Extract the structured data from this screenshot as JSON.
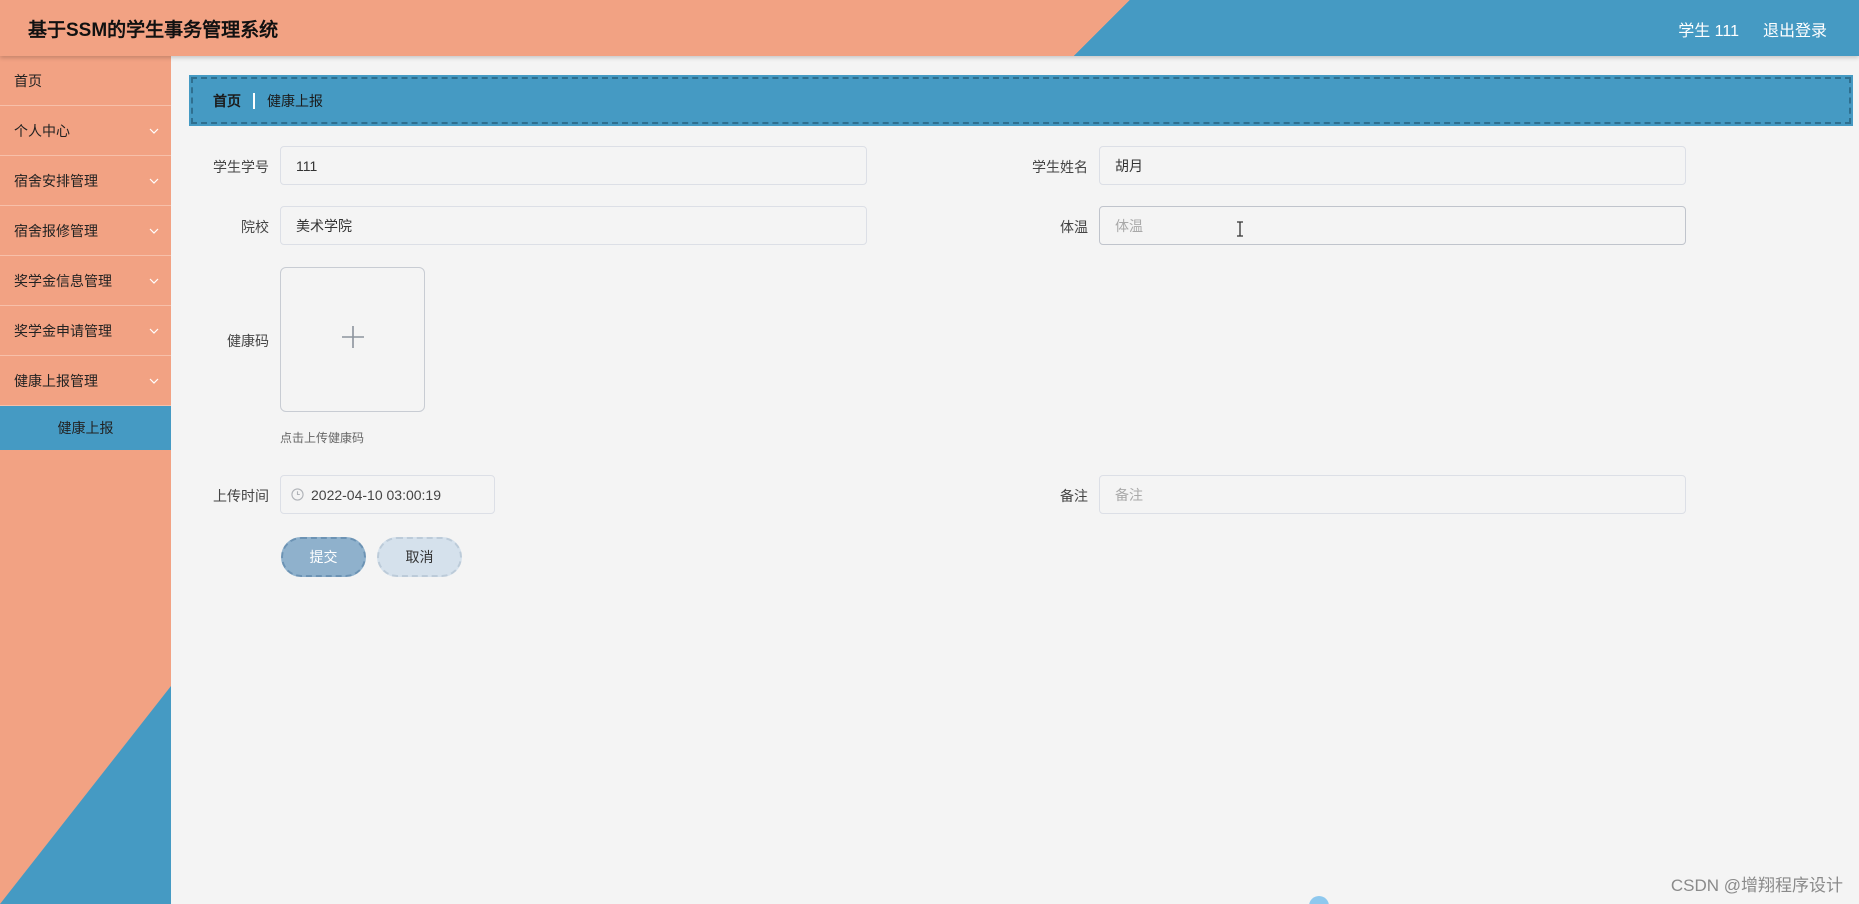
{
  "header": {
    "title": "基于SSM的学生事务管理系统",
    "user_label": "学生 111",
    "logout_label": "退出登录"
  },
  "sidebar": {
    "items": [
      {
        "label": "首页",
        "has_submenu": false
      },
      {
        "label": "个人中心",
        "has_submenu": true
      },
      {
        "label": "宿舍安排管理",
        "has_submenu": true
      },
      {
        "label": "宿舍报修管理",
        "has_submenu": true
      },
      {
        "label": "奖学金信息管理",
        "has_submenu": true
      },
      {
        "label": "奖学金申请管理",
        "has_submenu": true
      },
      {
        "label": "健康上报管理",
        "has_submenu": true
      }
    ],
    "active_sub_item": "健康上报"
  },
  "breadcrumb": {
    "home": "首页",
    "current": "健康上报"
  },
  "form": {
    "student_id": {
      "label": "学生学号",
      "value": "111"
    },
    "student_name": {
      "label": "学生姓名",
      "value": "胡月"
    },
    "college": {
      "label": "院校",
      "value": "美术学院"
    },
    "temperature": {
      "label": "体温",
      "value": "",
      "placeholder": "体温"
    },
    "health_code": {
      "label": "健康码",
      "upload_tip": "点击上传健康码"
    },
    "upload_time": {
      "label": "上传时间",
      "value": "2022-04-10 03:00:19"
    },
    "remark": {
      "label": "备注",
      "value": "",
      "placeholder": "备注"
    }
  },
  "buttons": {
    "submit": "提交",
    "cancel": "取消"
  },
  "watermark": "CSDN @增翔程序设计",
  "colors": {
    "salmon": "#f2a283",
    "blue": "#459ac3",
    "background": "#f4f4f4",
    "submit_button": "#8fb1cc",
    "cancel_button": "#d5e1ec"
  }
}
